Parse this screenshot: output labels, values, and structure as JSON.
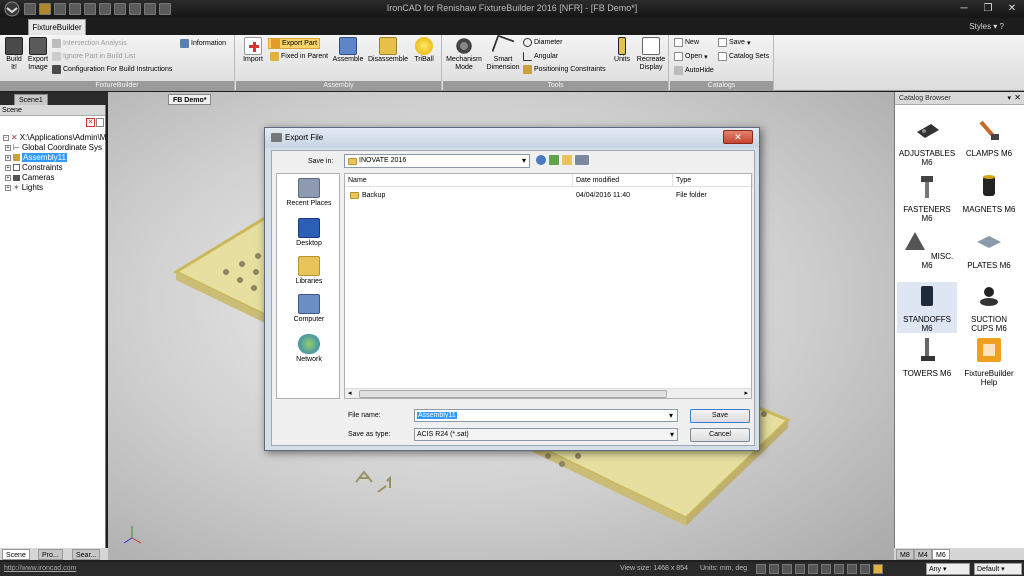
{
  "window": {
    "title": "IronCAD for Renishaw FixtureBuilder 2016 [NFR] - [FB Demo*]"
  },
  "ribbon": {
    "tab": "FixtureBuilder",
    "styles": "Styles",
    "groups": {
      "fixturebuilder": {
        "label": "FixtureBuilder",
        "build_it": "Build It!",
        "export_image": "Export Image",
        "intersection_analysis": "Intersection Analysis",
        "ignore_part": "Ignore Part in Build List",
        "configuration": "Configuration For Build Instructions",
        "information": "Information"
      },
      "assembly": {
        "label": "Assembly",
        "import": "Import",
        "export_part": "Export Part",
        "fixed_in_parent": "Fixed in Parent",
        "assemble": "Assemble",
        "disassemble": "Disassemble",
        "triball": "TriBall"
      },
      "tools": {
        "label": "Tools",
        "mechanism_mode": "Mechanism Mode",
        "smart_dimension": "Smart Dimension",
        "diameter": "Diameter",
        "angular": "Angular",
        "positioning_constraints": "Positioning Constraints",
        "units": "Units",
        "recreate_display": "Recreate Display"
      },
      "catalogs": {
        "label": "Catalogs",
        "new": "New",
        "open": "Open",
        "autohide": "AutoHide",
        "save": "Save",
        "catalog_sets": "Catalog Sets"
      }
    }
  },
  "doc_tabs": {
    "scene1": "Scene1",
    "fb_demo": "FB Demo*"
  },
  "scene_panel": {
    "header": "Scene",
    "items": [
      {
        "label": "X:\\Applications\\Admin\\M"
      },
      {
        "label": "Global Coordinate Sys"
      },
      {
        "label": "Assembly11"
      },
      {
        "label": "Constraints"
      },
      {
        "label": "Cameras"
      },
      {
        "label": "Lights"
      }
    ],
    "bottom_tabs": [
      "Scene",
      "Pro...",
      "Sear..."
    ]
  },
  "catalog": {
    "header": "Catalog Browser",
    "items": [
      {
        "label": "ADJUSTABLES M6"
      },
      {
        "label": "CLAMPS  M6"
      },
      {
        "label": "FASTENERS M6"
      },
      {
        "label": "MAGNETS  M6"
      },
      {
        "label": "MISC. M6"
      },
      {
        "label": "PLATES  M6"
      },
      {
        "label": "STANDOFFS M6"
      },
      {
        "label": "SUCTION CUPS  M6"
      },
      {
        "label": "TOWERS  M6"
      },
      {
        "label": "FixtureBuilder Help"
      }
    ],
    "tabs": [
      "M8",
      "M4",
      "M6"
    ]
  },
  "dialog": {
    "title": "Export File",
    "save_in_label": "Save in:",
    "save_in_value": "INOVATE 2016",
    "places": [
      "Recent Places",
      "Desktop",
      "Libraries",
      "Computer",
      "Network"
    ],
    "columns": [
      "Name",
      "Date modified",
      "Type"
    ],
    "files": [
      {
        "name": "Backup",
        "date": "04/04/2016 11:40",
        "type": "File folder"
      }
    ],
    "file_name_label": "File name:",
    "file_name_value": "Assembly11",
    "save_as_type_label": "Save as type:",
    "save_as_type_value": "ACIS R24 (*.sat)",
    "save_button": "Save",
    "cancel_button": "Cancel"
  },
  "statusbar": {
    "website": "http://www.ironcad.com",
    "view_size": "View size: 1468 x  854",
    "units": "Units: mm, deg",
    "filter": "Any",
    "mode": "Default"
  },
  "colors": {
    "accent": "#f0a020",
    "selection": "#3399ff",
    "plate": "#e8e2a0"
  }
}
